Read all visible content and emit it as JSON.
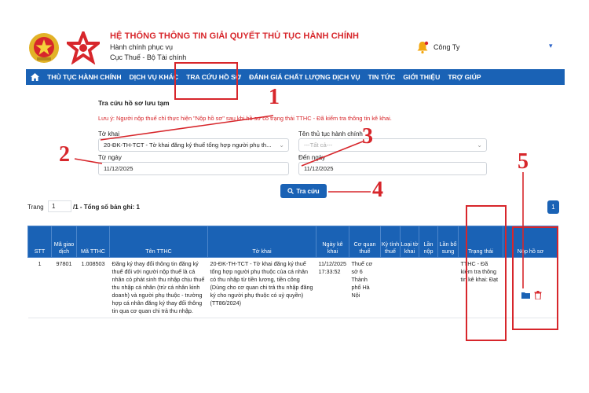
{
  "header": {
    "title": "HỆ THỐNG THÔNG TIN GIẢI QUYẾT THỦ TỤC HÀNH CHÍNH",
    "subtitle1": "Hành chính phục vụ",
    "subtitle2": "Cục Thuế - Bộ Tài chính",
    "user": "Công Ty"
  },
  "nav": {
    "items": [
      "THỦ TỤC HÀNH CHÍNH",
      "DỊCH VỤ KHÁC",
      "TRA CỨU HỒ SƠ",
      "ĐÁNH GIÁ CHẤT LƯỢNG DỊCH VỤ",
      "TIN TỨC",
      "GIỚI THIỆU",
      "TRỢ GIÚP"
    ]
  },
  "form": {
    "title": "Tra cứu hồ sơ lưu tạm",
    "note": "Lưu ý: Người nộp thuế chỉ thực hiện \"Nộp hồ sơ\" sau khi hồ sơ có trạng thái TTHC - Đã kiểm tra thông tin kê khai.",
    "tokhai_label": "Tờ khai",
    "tokhai_value": "20-ĐK-TH-TCT - Tờ khai đăng ký thuế tổng hợp người phụ th...",
    "tthc_label": "Tên thủ tục hành chính",
    "tthc_placeholder": "---Tất cả---",
    "from_label": "Từ ngày",
    "from_value": "11/12/2025",
    "to_label": "Đến ngày",
    "to_value": "11/12/2025",
    "search_label": "Tra cứu"
  },
  "pager": {
    "label": "Trang",
    "page": "1",
    "summary": "/1 - Tổng số bản ghi: 1",
    "badge": "1"
  },
  "table": {
    "headers": [
      "STT",
      "Mã giao dịch",
      "Mã TTHC",
      "Tên TTHC",
      "Tờ khai",
      "Ngày kê khai",
      "Cơ quan thuế",
      "Kỳ tính thuế",
      "Loại tờ khai",
      "Lần nộp",
      "Lần bổ sung",
      "Trạng thái",
      "Nộp hồ sơ"
    ],
    "rows": [
      {
        "stt": "1",
        "ma_gd": "97801",
        "ma_tthc": "1.008503",
        "ten": "Đăng ký thay đổi thông tin đăng ký thuế đối với người nộp thuế là cá nhân có phát sinh thu nhập chịu thuế thu nhập cá nhân (trừ cá nhân kinh doanh) và người phụ thuộc - trường hợp cá nhân đăng ký thay đổi thông tin qua cơ quan chi trả thu nhập.",
        "tokhai": "20-ĐK-TH-TCT - Tờ khai đăng ký thuế tổng hợp người phụ thuộc của cá nhân có thu nhập từ tiền lương, tiền công (Dùng cho cơ quan chi trả thu nhập đăng ký cho người phụ thuộc có uỷ quyền) (TT86/2024)",
        "ngay": "11/12/2025 17:33:52",
        "coquan": "Thuế cơ sở 6 Thành phố Hà Nội",
        "kytinh": "",
        "loai": "",
        "lannop": "",
        "lanbs": "",
        "trangthai": "TTHC - Đã kiểm tra thông tin kê khai: Đạt"
      }
    ]
  },
  "annotations": [
    "1",
    "2",
    "3",
    "4",
    "5"
  ],
  "colors": {
    "primary": "#1a62b5",
    "accent": "#d7262b"
  }
}
